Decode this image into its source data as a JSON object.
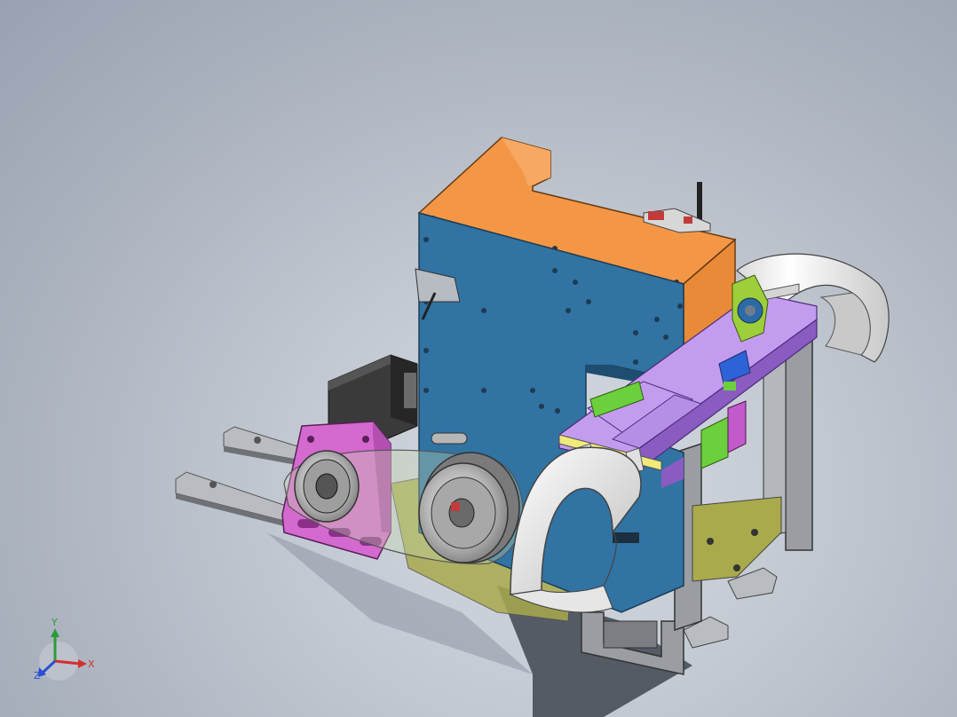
{
  "viewport": {
    "background_top": "#98a2b1",
    "background_center": "#d6dbe2"
  },
  "model": {
    "parts": [
      "orange-top-cover",
      "blue-main-plate",
      "servo-motor",
      "pink-motor-mount",
      "small-timing-pulley",
      "large-timing-pulley",
      "timing-belt",
      "white-feed-roll-front",
      "white-feed-roll-rear",
      "purple-slide-frame",
      "green-gear-plate",
      "linear-guide-rails",
      "grey-support-frame"
    ],
    "colors": {
      "orange": "#f39747",
      "blue": "#3173a3",
      "pink": "#d46ad0",
      "purple": "#8a5cc2",
      "lavender": "#c39bef",
      "green": "#9ccf3a",
      "olive": "#a9aa4c",
      "grey": "#8a8d92",
      "white": "#f2f2f2"
    }
  },
  "triad": {
    "x_label": "X",
    "y_label": "Y",
    "z_label": "Z",
    "x_color": "#d23030",
    "y_color": "#2d9b3a",
    "z_color": "#2a4fd0"
  }
}
